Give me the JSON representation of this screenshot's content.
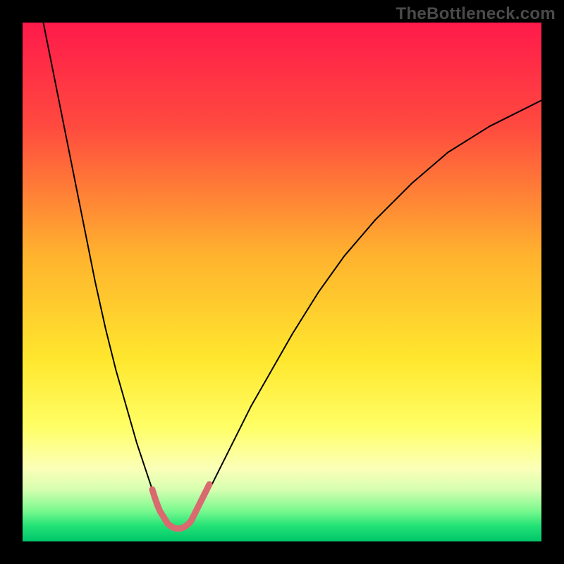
{
  "watermark": "TheBottleneck.com",
  "chart_data": {
    "type": "line",
    "title": "",
    "xlabel": "",
    "ylabel": "",
    "xlim": [
      0,
      100
    ],
    "ylim": [
      0,
      100
    ],
    "grid": false,
    "legend": false,
    "gradient_stops": [
      {
        "offset": 0.0,
        "color": "#ff1a4b"
      },
      {
        "offset": 0.2,
        "color": "#ff4a3f"
      },
      {
        "offset": 0.45,
        "color": "#ffb32e"
      },
      {
        "offset": 0.65,
        "color": "#ffe72e"
      },
      {
        "offset": 0.78,
        "color": "#ffff66"
      },
      {
        "offset": 0.86,
        "color": "#fbffb8"
      },
      {
        "offset": 0.9,
        "color": "#d6ffb0"
      },
      {
        "offset": 0.94,
        "color": "#7cf98f"
      },
      {
        "offset": 0.97,
        "color": "#23e276"
      },
      {
        "offset": 1.0,
        "color": "#00c66a"
      }
    ],
    "series": [
      {
        "name": "left-curve",
        "color": "#000000",
        "width": 2,
        "x": [
          4,
          6,
          8,
          10,
          12,
          14,
          16,
          18,
          20,
          22,
          24,
          25,
          26,
          27,
          28
        ],
        "y": [
          100,
          90,
          80,
          70,
          60,
          50,
          41,
          33,
          26,
          19,
          13,
          10,
          7,
          5,
          3
        ]
      },
      {
        "name": "right-curve",
        "color": "#000000",
        "width": 2,
        "x": [
          32,
          34,
          36,
          38,
          41,
          44,
          48,
          52,
          57,
          62,
          68,
          75,
          82,
          90,
          100
        ],
        "y": [
          3,
          6,
          10,
          14,
          20,
          26,
          33,
          40,
          48,
          55,
          62,
          69,
          75,
          80,
          85
        ]
      },
      {
        "name": "left-highlight",
        "color": "#d96a6f",
        "width": 9,
        "linecap": "round",
        "x": [
          25.0,
          25.5,
          26.0,
          26.5,
          27.0,
          27.5,
          28.0,
          28.5
        ],
        "y": [
          10.0,
          8.4,
          7.0,
          5.8,
          5.0,
          4.2,
          3.4,
          3.0
        ]
      },
      {
        "name": "bottom-highlight",
        "color": "#d96a6f",
        "width": 9,
        "linecap": "round",
        "x": [
          28.5,
          29.0,
          29.5,
          30.0,
          30.5,
          31.0,
          31.5
        ],
        "y": [
          3.0,
          2.7,
          2.5,
          2.5,
          2.5,
          2.7,
          3.0
        ]
      },
      {
        "name": "right-highlight",
        "color": "#d96a6f",
        "width": 9,
        "linecap": "round",
        "x": [
          31.5,
          32.0,
          32.5,
          33.0,
          33.5,
          34.0,
          34.5,
          35.0,
          35.5,
          36.0
        ],
        "y": [
          3.0,
          3.4,
          4.0,
          5.0,
          6.0,
          7.0,
          8.0,
          9.0,
          10.0,
          11.0
        ]
      }
    ]
  }
}
